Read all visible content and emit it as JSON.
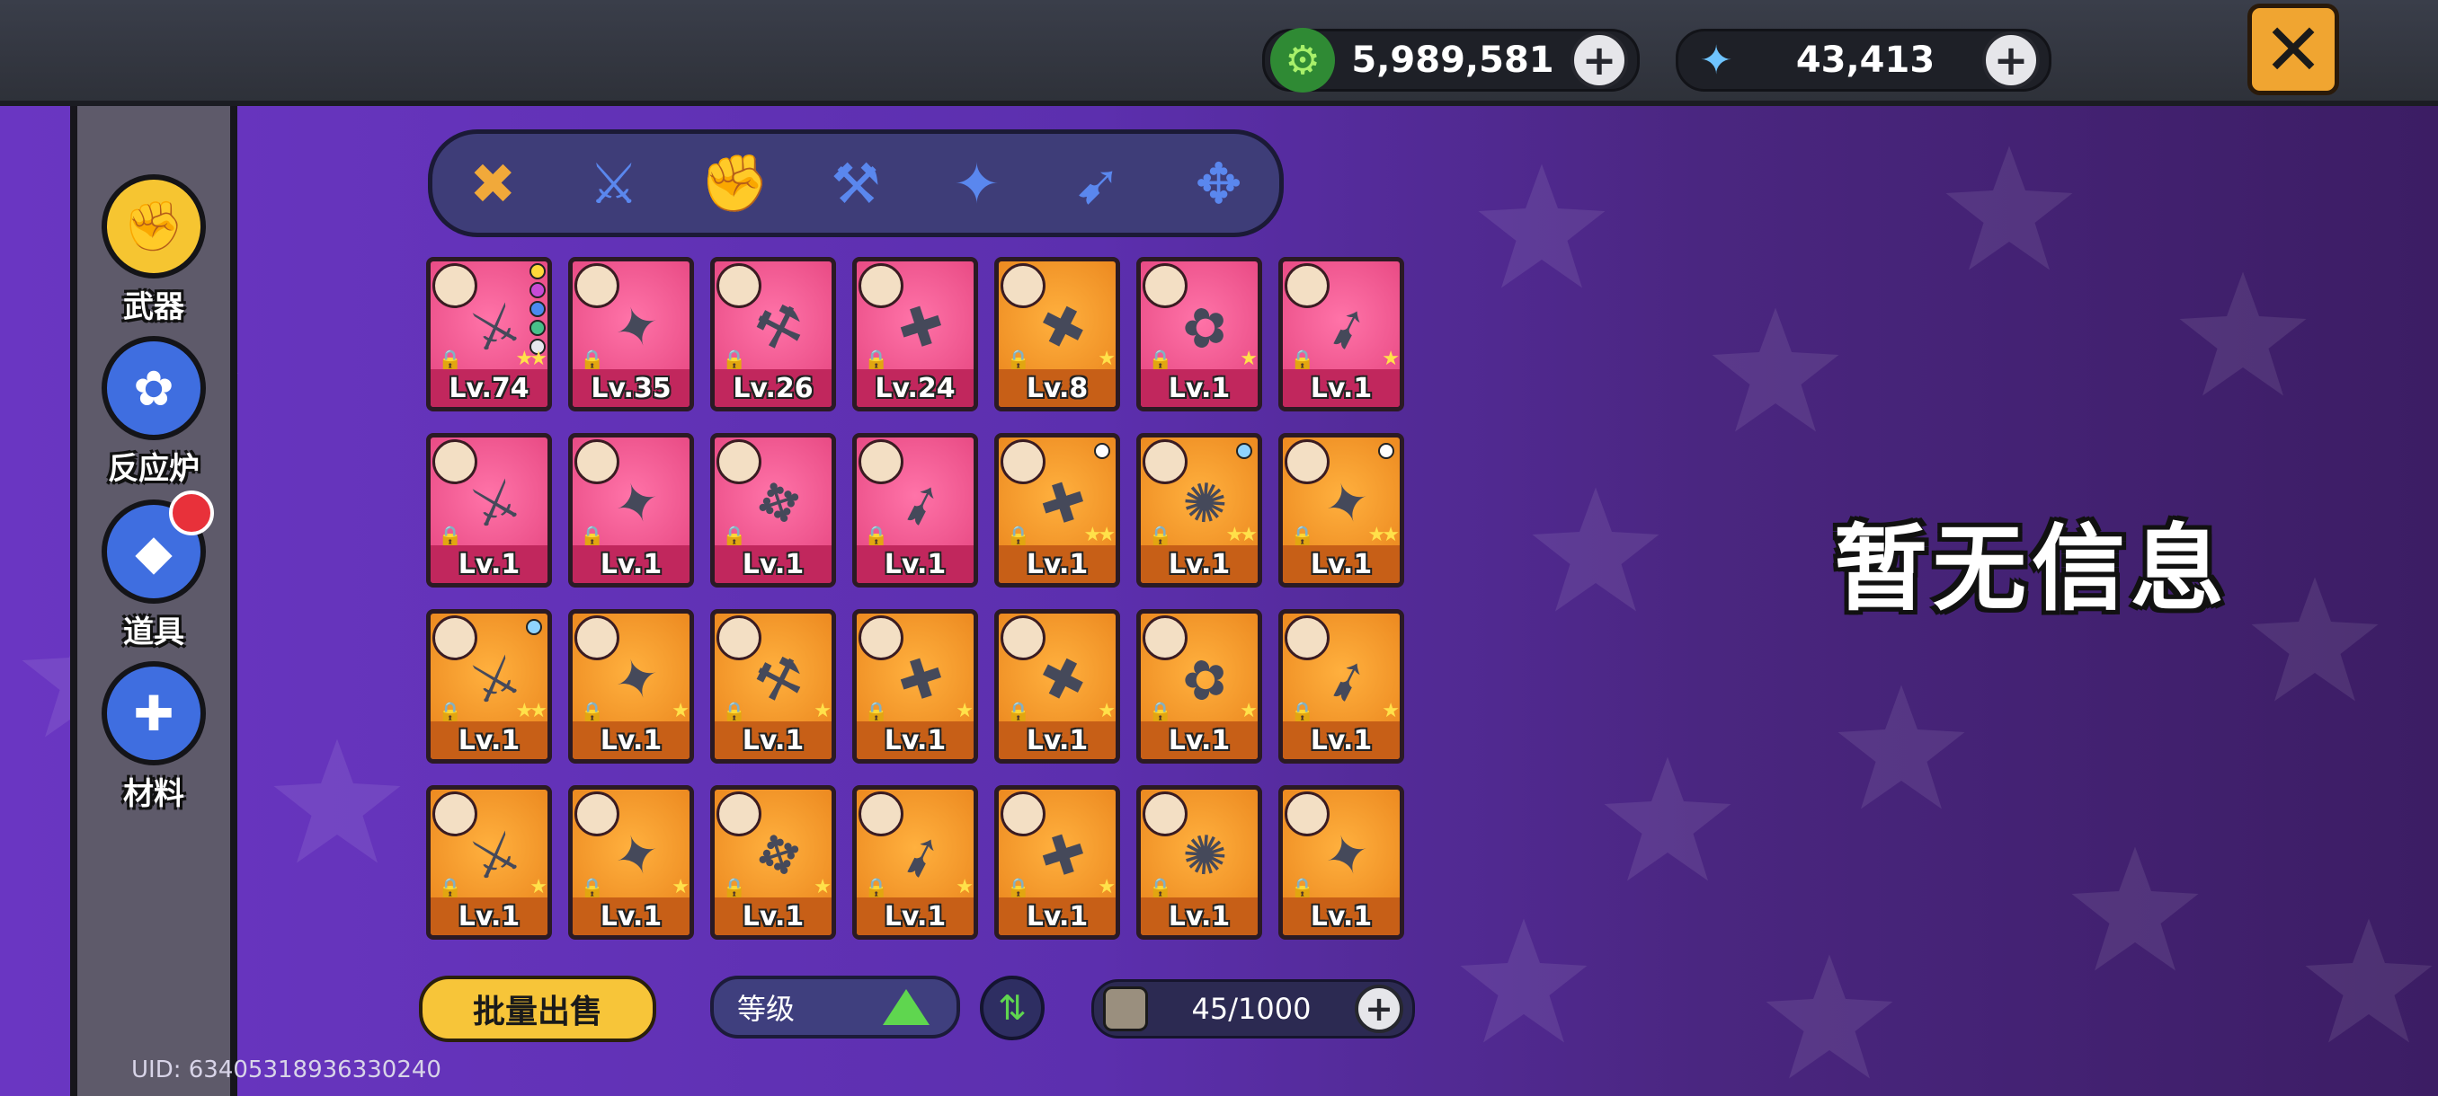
{
  "header": {
    "currency_gold": {
      "icon": "green-gear-coin-icon",
      "value": "5,989,581"
    },
    "currency_crystal": {
      "icon": "blue-crystal-icon",
      "value": "43,413"
    },
    "close_icon": "close-x-icon"
  },
  "sidebar": {
    "items": [
      {
        "label": "武器",
        "icon": "fist-icon",
        "active": true
      },
      {
        "label": "反应炉",
        "icon": "gear-icon",
        "active": false
      },
      {
        "label": "道具",
        "icon": "ticket-icon",
        "active": false,
        "badge": true
      },
      {
        "label": "材料",
        "icon": "puzzle-icon",
        "active": false
      }
    ]
  },
  "filter_tabs": [
    {
      "icon": "all-weapons-icon",
      "active": true
    },
    {
      "icon": "sword-icon",
      "active": false
    },
    {
      "icon": "fist-icon",
      "active": false
    },
    {
      "icon": "hammer-icon",
      "active": false
    },
    {
      "icon": "gun-icon",
      "active": false
    },
    {
      "icon": "launcher-icon",
      "active": false
    },
    {
      "icon": "dual-gun-icon",
      "active": false
    }
  ],
  "weapons": [
    {
      "level": "Lv.74",
      "rarity": "pink",
      "stars": 2
    },
    {
      "level": "Lv.35",
      "rarity": "pink",
      "stars": 0
    },
    {
      "level": "Lv.26",
      "rarity": "pink",
      "stars": 0
    },
    {
      "level": "Lv.24",
      "rarity": "pink",
      "stars": 0
    },
    {
      "level": "Lv.8",
      "rarity": "orange",
      "stars": 1
    },
    {
      "level": "Lv.1",
      "rarity": "pink",
      "stars": 1
    },
    {
      "level": "Lv.1",
      "rarity": "pink",
      "stars": 1
    },
    {
      "level": "Lv.1",
      "rarity": "pink",
      "stars": 0
    },
    {
      "level": "Lv.1",
      "rarity": "pink",
      "stars": 0
    },
    {
      "level": "Lv.1",
      "rarity": "pink",
      "stars": 0
    },
    {
      "level": "Lv.1",
      "rarity": "pink",
      "stars": 0
    },
    {
      "level": "Lv.1",
      "rarity": "orange",
      "stars": 2
    },
    {
      "level": "Lv.1",
      "rarity": "orange",
      "stars": 2
    },
    {
      "level": "Lv.1",
      "rarity": "orange",
      "stars": 2
    },
    {
      "level": "Lv.1",
      "rarity": "orange",
      "stars": 2
    },
    {
      "level": "Lv.1",
      "rarity": "orange",
      "stars": 1
    },
    {
      "level": "Lv.1",
      "rarity": "orange",
      "stars": 1
    },
    {
      "level": "Lv.1",
      "rarity": "orange",
      "stars": 1
    },
    {
      "level": "Lv.1",
      "rarity": "orange",
      "stars": 1
    },
    {
      "level": "Lv.1",
      "rarity": "orange",
      "stars": 1
    },
    {
      "level": "Lv.1",
      "rarity": "orange",
      "stars": 1
    },
    {
      "level": "Lv.1",
      "rarity": "orange",
      "stars": 1
    },
    {
      "level": "Lv.1",
      "rarity": "orange",
      "stars": 1
    },
    {
      "level": "Lv.1",
      "rarity": "orange",
      "stars": 1
    },
    {
      "level": "Lv.1",
      "rarity": "orange",
      "stars": 1
    },
    {
      "level": "Lv.1",
      "rarity": "orange",
      "stars": 1
    },
    {
      "level": "Lv.1",
      "rarity": "orange",
      "stars": 0
    },
    {
      "level": "Lv.1",
      "rarity": "orange",
      "stars": 0
    }
  ],
  "bottom": {
    "bulk_sell": "批量出售",
    "sort_label": "等级",
    "capacity": "45/1000"
  },
  "detail_panel": {
    "empty_text": "暂无信息"
  },
  "uid": "UID: 634053189363302​40"
}
